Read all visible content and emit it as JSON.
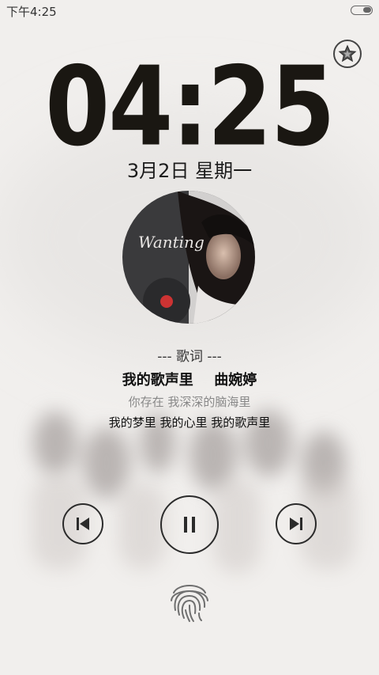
{
  "status_bar": {
    "time": "下午4:25",
    "battery_icon": "battery-icon"
  },
  "lockscreen": {
    "clock": "04:25",
    "date": "3月2日 星期一",
    "favorite_icon": "star-icon"
  },
  "album": {
    "cover_text": "Wanting",
    "cover_icon": "album-cover-icon"
  },
  "lyrics": {
    "header": "--- 歌词 ---",
    "song_title": "我的歌声里",
    "artist": "曲婉婷",
    "line_previous": "你存在 我深深的脑海里",
    "line_current": "我的梦里 我的心里 我的歌声里"
  },
  "controls": {
    "prev_icon": "skip-previous-icon",
    "pause_icon": "pause-icon",
    "next_icon": "skip-next-icon"
  },
  "unlock": {
    "fingerprint_icon": "fingerprint-icon"
  },
  "colors": {
    "background": "#f1efed",
    "clock": "#1a1712",
    "text_dim": "#888888"
  }
}
